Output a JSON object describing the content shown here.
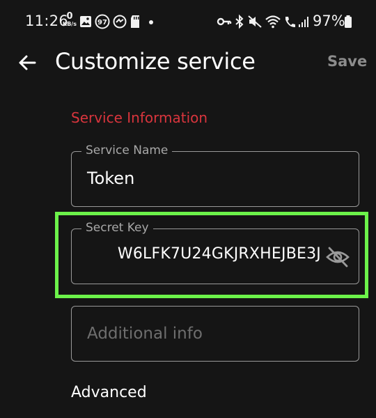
{
  "status_bar": {
    "time": "11:26",
    "net_speed_value": "0",
    "net_speed_unit": "KB/s",
    "notification_badge": "97",
    "battery": "97%"
  },
  "app_bar": {
    "title": "Customize service",
    "save_label": "Save"
  },
  "section": {
    "title": "Service Information",
    "title_color": "#d9353d"
  },
  "fields": {
    "service_name": {
      "label": "Service Name",
      "value": "Token"
    },
    "secret_key": {
      "label": "Secret Key",
      "value": "W6LFK7U24GKJRXHEJBE3J",
      "visibility_icon": "eye-off-icon"
    },
    "additional_info": {
      "placeholder": "Additional info"
    }
  },
  "advanced_label": "Advanced",
  "highlight_color": "#6cf24a"
}
